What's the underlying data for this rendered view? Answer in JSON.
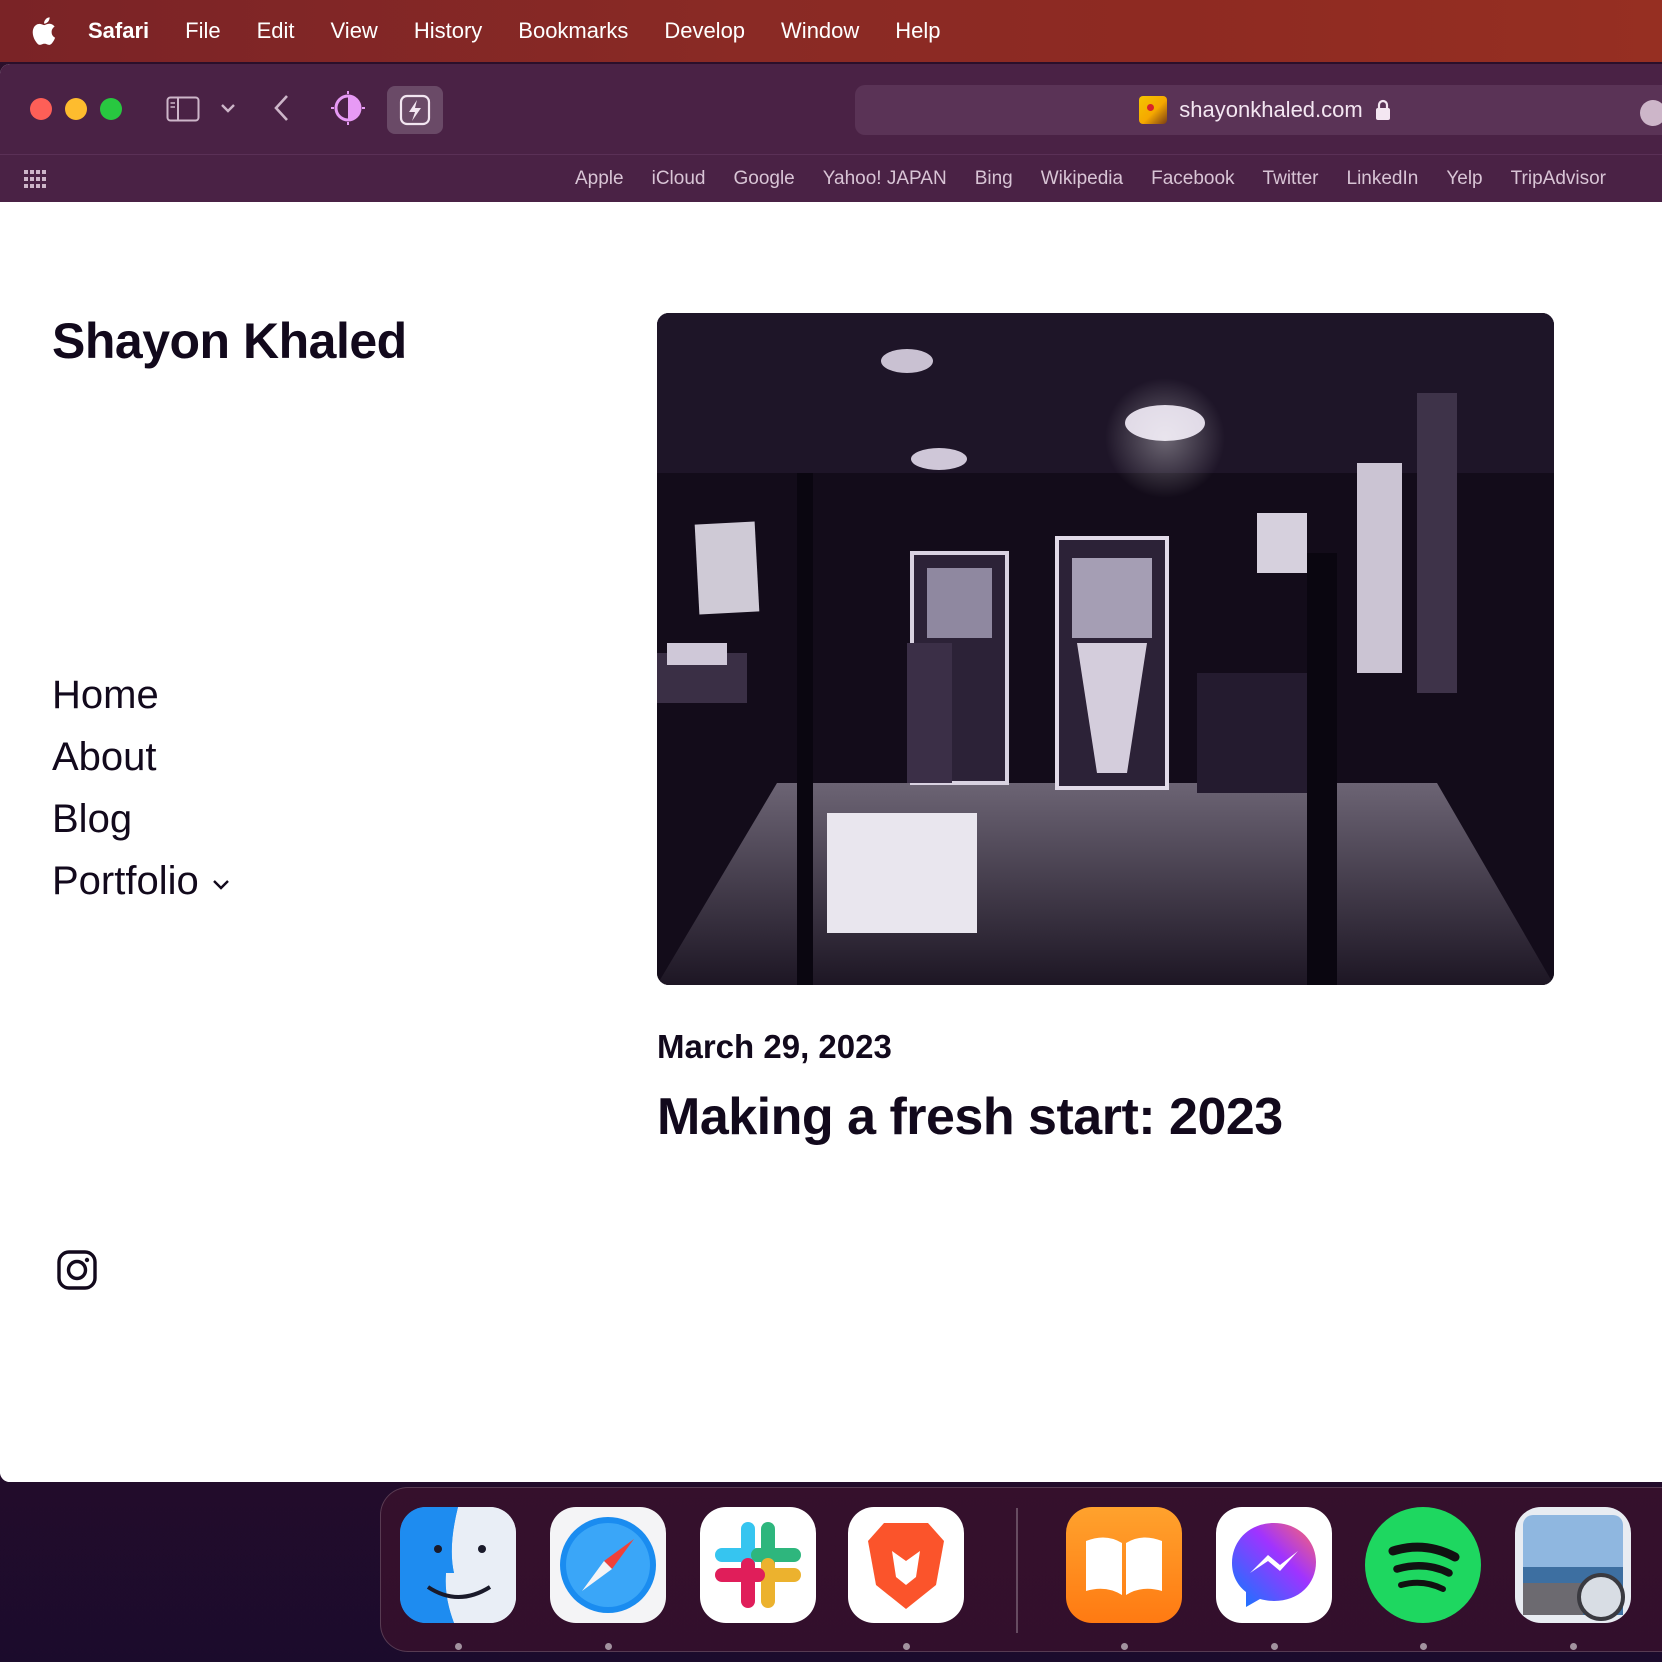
{
  "menubar": {
    "app_name": "Safari",
    "items": [
      "File",
      "Edit",
      "View",
      "History",
      "Bookmarks",
      "Develop",
      "Window",
      "Help"
    ]
  },
  "browser": {
    "url": "shayonkhaled.com",
    "favorites": [
      "Apple",
      "iCloud",
      "Google",
      "Yahoo! JAPAN",
      "Bing",
      "Wikipedia",
      "Facebook",
      "Twitter",
      "LinkedIn",
      "Yelp",
      "TripAdvisor"
    ]
  },
  "site": {
    "title": "Shayon Khaled",
    "nav": {
      "home": "Home",
      "about": "About",
      "blog": "Blog",
      "portfolio": "Portfolio"
    },
    "post": {
      "date": "March 29, 2023",
      "title": "Making a fresh start: 2023"
    }
  },
  "dock": {
    "apps": [
      "finder",
      "safari",
      "slack",
      "brave",
      "books",
      "messenger",
      "spotify",
      "preview"
    ]
  },
  "colors": {
    "menubar": "#8a2a25",
    "toolbar": "#4a2245",
    "text": "#12091c"
  }
}
